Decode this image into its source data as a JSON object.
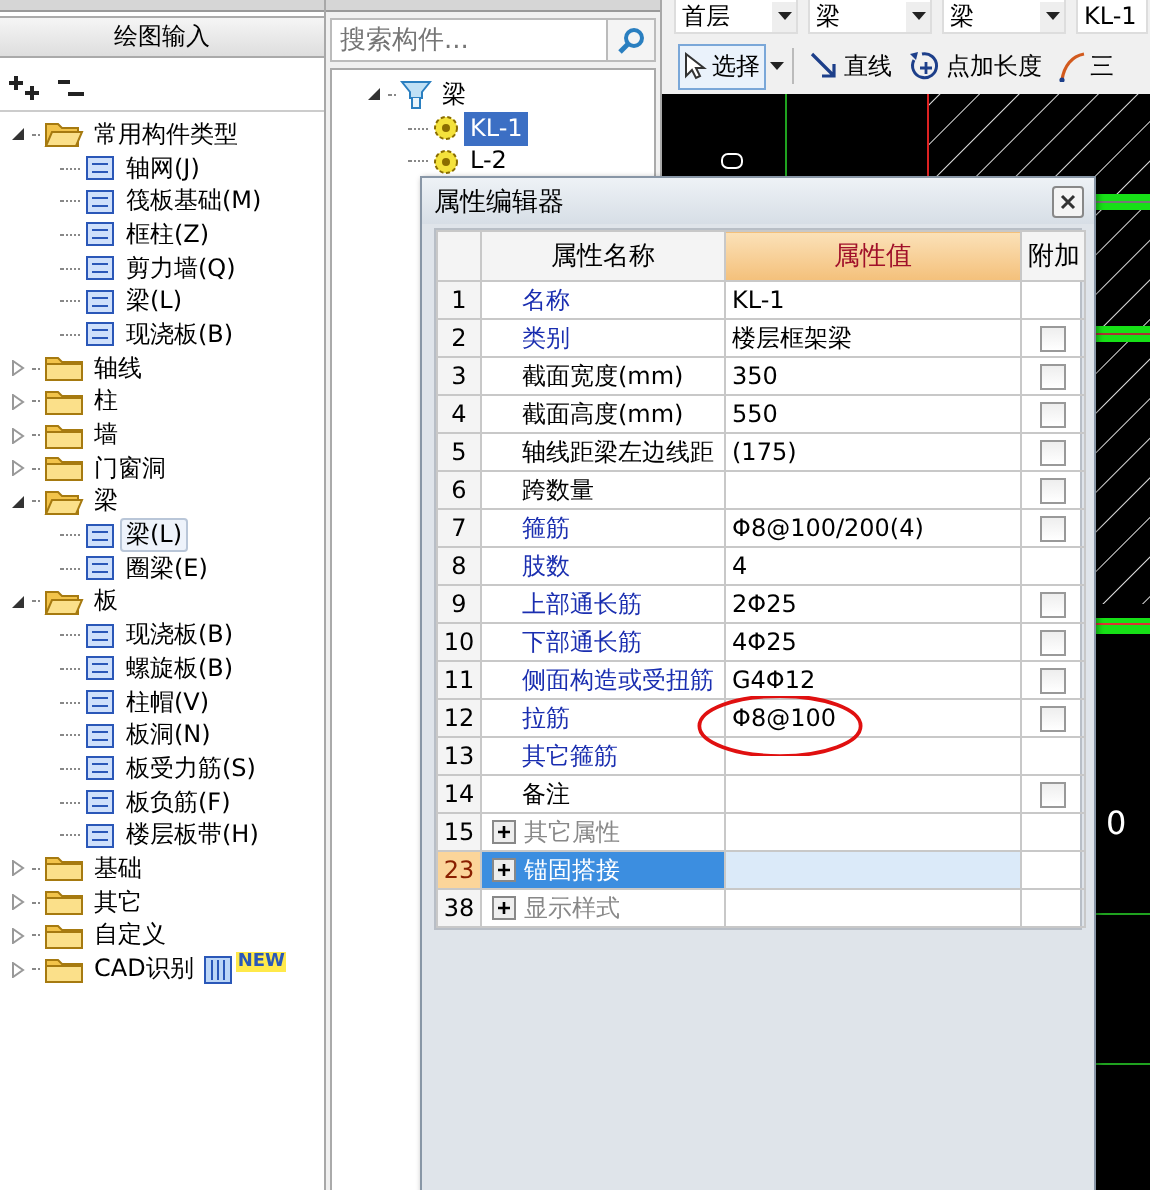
{
  "left_panel": {
    "title": "绘图输入",
    "tree": [
      {
        "label": "常用构件类型",
        "expanded": true,
        "selected": false,
        "children": [
          {
            "label": "轴网(J)",
            "selected": false
          },
          {
            "label": "筏板基础(M)",
            "selected": false
          },
          {
            "label": "框柱(Z)",
            "selected": false
          },
          {
            "label": "剪力墙(Q)",
            "selected": false
          },
          {
            "label": "梁(L)",
            "selected": false
          },
          {
            "label": "现浇板(B)",
            "selected": false
          }
        ]
      },
      {
        "label": "轴线",
        "expanded": false,
        "selected": false
      },
      {
        "label": "柱",
        "expanded": false,
        "selected": false
      },
      {
        "label": "墙",
        "expanded": false,
        "selected": false
      },
      {
        "label": "门窗洞",
        "expanded": false,
        "selected": false
      },
      {
        "label": "梁",
        "expanded": true,
        "selected": false,
        "children": [
          {
            "label": "梁(L)",
            "selected": true
          },
          {
            "label": "圈梁(E)",
            "selected": false
          }
        ]
      },
      {
        "label": "板",
        "expanded": true,
        "selected": false,
        "children": [
          {
            "label": "现浇板(B)",
            "selected": false
          },
          {
            "label": "螺旋板(B)",
            "selected": false
          },
          {
            "label": "柱帽(V)",
            "selected": false
          },
          {
            "label": "板洞(N)",
            "selected": false
          },
          {
            "label": "板受力筋(S)",
            "selected": false
          },
          {
            "label": "板负筋(F)",
            "selected": false
          },
          {
            "label": "楼层板带(H)",
            "selected": false
          }
        ]
      },
      {
        "label": "基础",
        "expanded": false,
        "selected": false
      },
      {
        "label": "其它",
        "expanded": false,
        "selected": false
      },
      {
        "label": "自定义",
        "expanded": false,
        "selected": false
      },
      {
        "label": "CAD识别",
        "expanded": false,
        "selected": false,
        "badge": "NEW"
      }
    ]
  },
  "component_panel": {
    "search": {
      "placeholder": "搜索构件..."
    },
    "tree": [
      {
        "label": "梁",
        "expanded": true,
        "selected": false,
        "children": [
          {
            "label": "KL-1",
            "selected": true
          },
          {
            "label": "L-2",
            "selected": false
          }
        ]
      }
    ]
  },
  "selectors": [
    "首层",
    "梁",
    "梁",
    "KL-1"
  ],
  "draw_toolbar": [
    {
      "label": "选择",
      "kind": "select",
      "selected": true
    },
    {
      "label": "直线",
      "kind": "line",
      "selected": false
    },
    {
      "label": "点加长度",
      "kind": "point-length",
      "selected": false
    },
    {
      "label": "三",
      "kind": "arc",
      "selected": false
    }
  ],
  "canvas": {
    "label": "0"
  },
  "property_editor": {
    "title": "属性编辑器",
    "columns": [
      "属性名称",
      "属性值",
      "附加"
    ],
    "rows": [
      {
        "num": "1",
        "name": "名称",
        "value": "KL-1",
        "kind": "common",
        "checkable": false
      },
      {
        "num": "2",
        "name": "类别",
        "value": "楼层框架梁",
        "kind": "common",
        "checkable": true,
        "checked": false
      },
      {
        "num": "3",
        "name": "截面宽度(mm)",
        "value": "350",
        "kind": "private",
        "checkable": true,
        "checked": false
      },
      {
        "num": "4",
        "name": "截面高度(mm)",
        "value": "550",
        "kind": "private",
        "checkable": true,
        "checked": false
      },
      {
        "num": "5",
        "name": "轴线距梁左边线距",
        "value": "(175)",
        "kind": "private",
        "checkable": true,
        "checked": false
      },
      {
        "num": "6",
        "name": "跨数量",
        "kind": "private",
        "checkable": true,
        "checked": false
      },
      {
        "num": "7",
        "name": "箍筋",
        "value": "Φ8@100/200(4)",
        "kind": "common",
        "checkable": true,
        "checked": false
      },
      {
        "num": "8",
        "name": "肢数",
        "value": "4",
        "kind": "common",
        "checkable": false
      },
      {
        "num": "9",
        "name": "上部通长筋",
        "value": "2Φ25",
        "kind": "common",
        "checkable": true,
        "checked": false
      },
      {
        "num": "10",
        "name": "下部通长筋",
        "value": "4Φ25",
        "kind": "common",
        "checkable": true,
        "checked": false
      },
      {
        "num": "11",
        "name": "侧面构造或受扭筋",
        "value": "G4Φ12",
        "kind": "common",
        "checkable": true,
        "checked": false
      },
      {
        "num": "12",
        "name": "拉筋",
        "value": "Φ8@100",
        "kind": "common",
        "checkable": true,
        "checked": false,
        "circled": true
      },
      {
        "num": "13",
        "name": "其它箍筋",
        "kind": "common",
        "checkable": false
      },
      {
        "num": "14",
        "name": "备注",
        "kind": "private",
        "checkable": true,
        "checked": false
      },
      {
        "num": "15",
        "name": "其它属性",
        "kind": "group",
        "selected": false
      },
      {
        "num": "23",
        "name": "锚固搭接",
        "kind": "group",
        "selected": true
      },
      {
        "num": "38",
        "name": "显示样式",
        "kind": "group",
        "selected": false
      }
    ]
  }
}
